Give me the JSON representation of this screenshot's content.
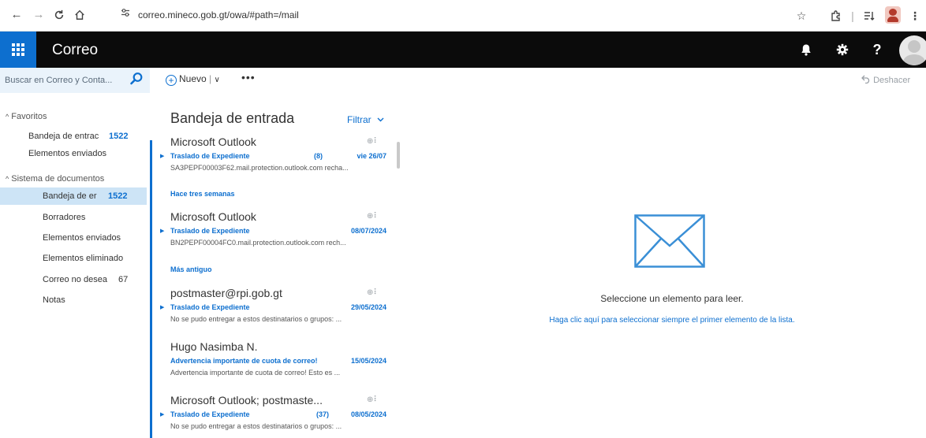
{
  "browser": {
    "url": "correo.mineco.gob.gt/owa/#path=/mail",
    "nav_icons": [
      "back-arrow-icon",
      "forward-arrow-icon",
      "reload-icon",
      "home-icon"
    ],
    "site_info_icon": "tune-icon",
    "right_icons": [
      "star-icon",
      "extensions-icon",
      "separator",
      "reading-list-icon",
      "profile-avatar",
      "kebab-menu-icon"
    ]
  },
  "app": {
    "title": "Correo",
    "accent_color": "#0d6fcf",
    "bar_color": "#0b0b0b",
    "header_icons": [
      "bell-icon",
      "gear-icon",
      "help-icon"
    ]
  },
  "search": {
    "placeholder": "Buscar en Correo y Conta..."
  },
  "toolbar": {
    "new_label": "Nuevo",
    "new_split": "|",
    "new_dropdown": "∨",
    "more_label": "•••",
    "undo_label": "Deshacer"
  },
  "folders": {
    "favorites_header": "Favoritos",
    "favorites": [
      {
        "name": "Bandeja de entrac",
        "count": "1522"
      },
      {
        "name": "Elementos enviados",
        "count": ""
      }
    ],
    "system_header": "Sistema de documentos",
    "system": [
      {
        "name": "Bandeja de er",
        "count": "1522",
        "selected": true
      },
      {
        "name": "Borradores",
        "count": ""
      },
      {
        "name": "Elementos enviados",
        "count": ""
      },
      {
        "name": "Elementos eliminado",
        "count": ""
      },
      {
        "name": "Correo no desea",
        "count": "67"
      },
      {
        "name": "Notas",
        "count": ""
      }
    ]
  },
  "message_list": {
    "title": "Bandeja de entrada",
    "filter_label": "Filtrar",
    "groups": {
      "three_weeks": "Hace tres semanas",
      "older": "Más antiguo"
    },
    "messages": [
      {
        "sender": "Microsoft Outlook",
        "subject": "Traslado de Expediente",
        "count": "(8)",
        "date": "vie 26/07",
        "preview": "SA3PEPF00003F62.mail.protection.outlook.com recha...",
        "has_thread": true
      },
      {
        "sender": "Microsoft Outlook",
        "subject": "Traslado de Expediente",
        "count": "",
        "date": "08/07/2024",
        "preview": "BN2PEPF00004FC0.mail.protection.outlook.com rech...",
        "has_thread": true
      },
      {
        "sender": "postmaster@rpi.gob.gt",
        "subject": "Traslado de Expediente",
        "count": "",
        "date": "29/05/2024",
        "preview": "No se pudo entregar a estos destinatarios o grupos: ...",
        "has_thread": true
      },
      {
        "sender": "Hugo Nasimba N.",
        "subject": "Advertencia importante de cuota de correo!",
        "count": "",
        "date": "15/05/2024",
        "preview": "Advertencia importante de cuota de correo! Esto es ...",
        "has_thread": false
      },
      {
        "sender": "Microsoft Outlook; postmaste...",
        "subject": "Traslado de Expediente",
        "count": "(37)",
        "date": "08/05/2024",
        "preview": "No se pudo entregar a estos destinatarios o grupos: ...",
        "has_thread": true
      }
    ]
  },
  "reading_pane": {
    "empty_message": "Seleccione un elemento para leer.",
    "select_first_link": "Haga clic aquí para seleccionar siempre el primer elemento de la lista."
  }
}
